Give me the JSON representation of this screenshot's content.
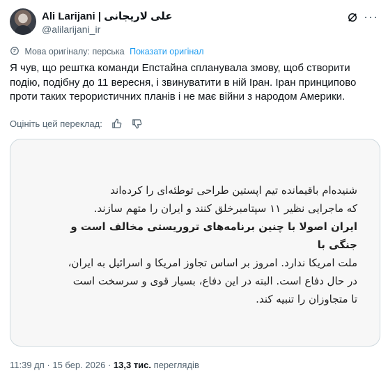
{
  "author": {
    "name": "Ali Larijani | علی لاریجانی",
    "handle": "@alilarijani_ir"
  },
  "translation": {
    "label": "Мова оригіналу: перська",
    "show_original": "Показати оригінал"
  },
  "tweet_text": "Я чув, що рештка команди Епстайна спланувала змову, щоб створити подію, подібну до 11 вересня, і звинуватити в ній Іран. Іран принципово проти таких терористичних планів і не має війни з народом Америки.",
  "rate_translation": "Оцініть цей переклад:",
  "image_text": {
    "lines": [
      "شنیده‌ام باقیمانده تیم اپستین طراحی توطئه‌ای را کرده‌اند",
      "که ماجرایی نظیر ۱۱ سپتامبرخلق کنند و ایران را متهم سازند.",
      "ایران اصولا با چنین برنامه‌های تروریستی مخالف است و جنگی با",
      "ملت امریکا ندارد. امروز بر اساس تجاوز امریکا و اسرائیل به ایران،",
      "در حال دفاع است. البته در این دفاع، بسیار قوی و سرسخت است",
      "تا متجاوزان را تنبیه کند."
    ]
  },
  "footer": {
    "time": "11:39 дп · 15 бер. 2026 ·",
    "views_count": "13,3 тис.",
    "views_label": "переглядів"
  },
  "icons": [
    "grok-icon",
    "more-icon",
    "translate-icon",
    "thumbs-up-icon",
    "thumbs-down-icon"
  ]
}
